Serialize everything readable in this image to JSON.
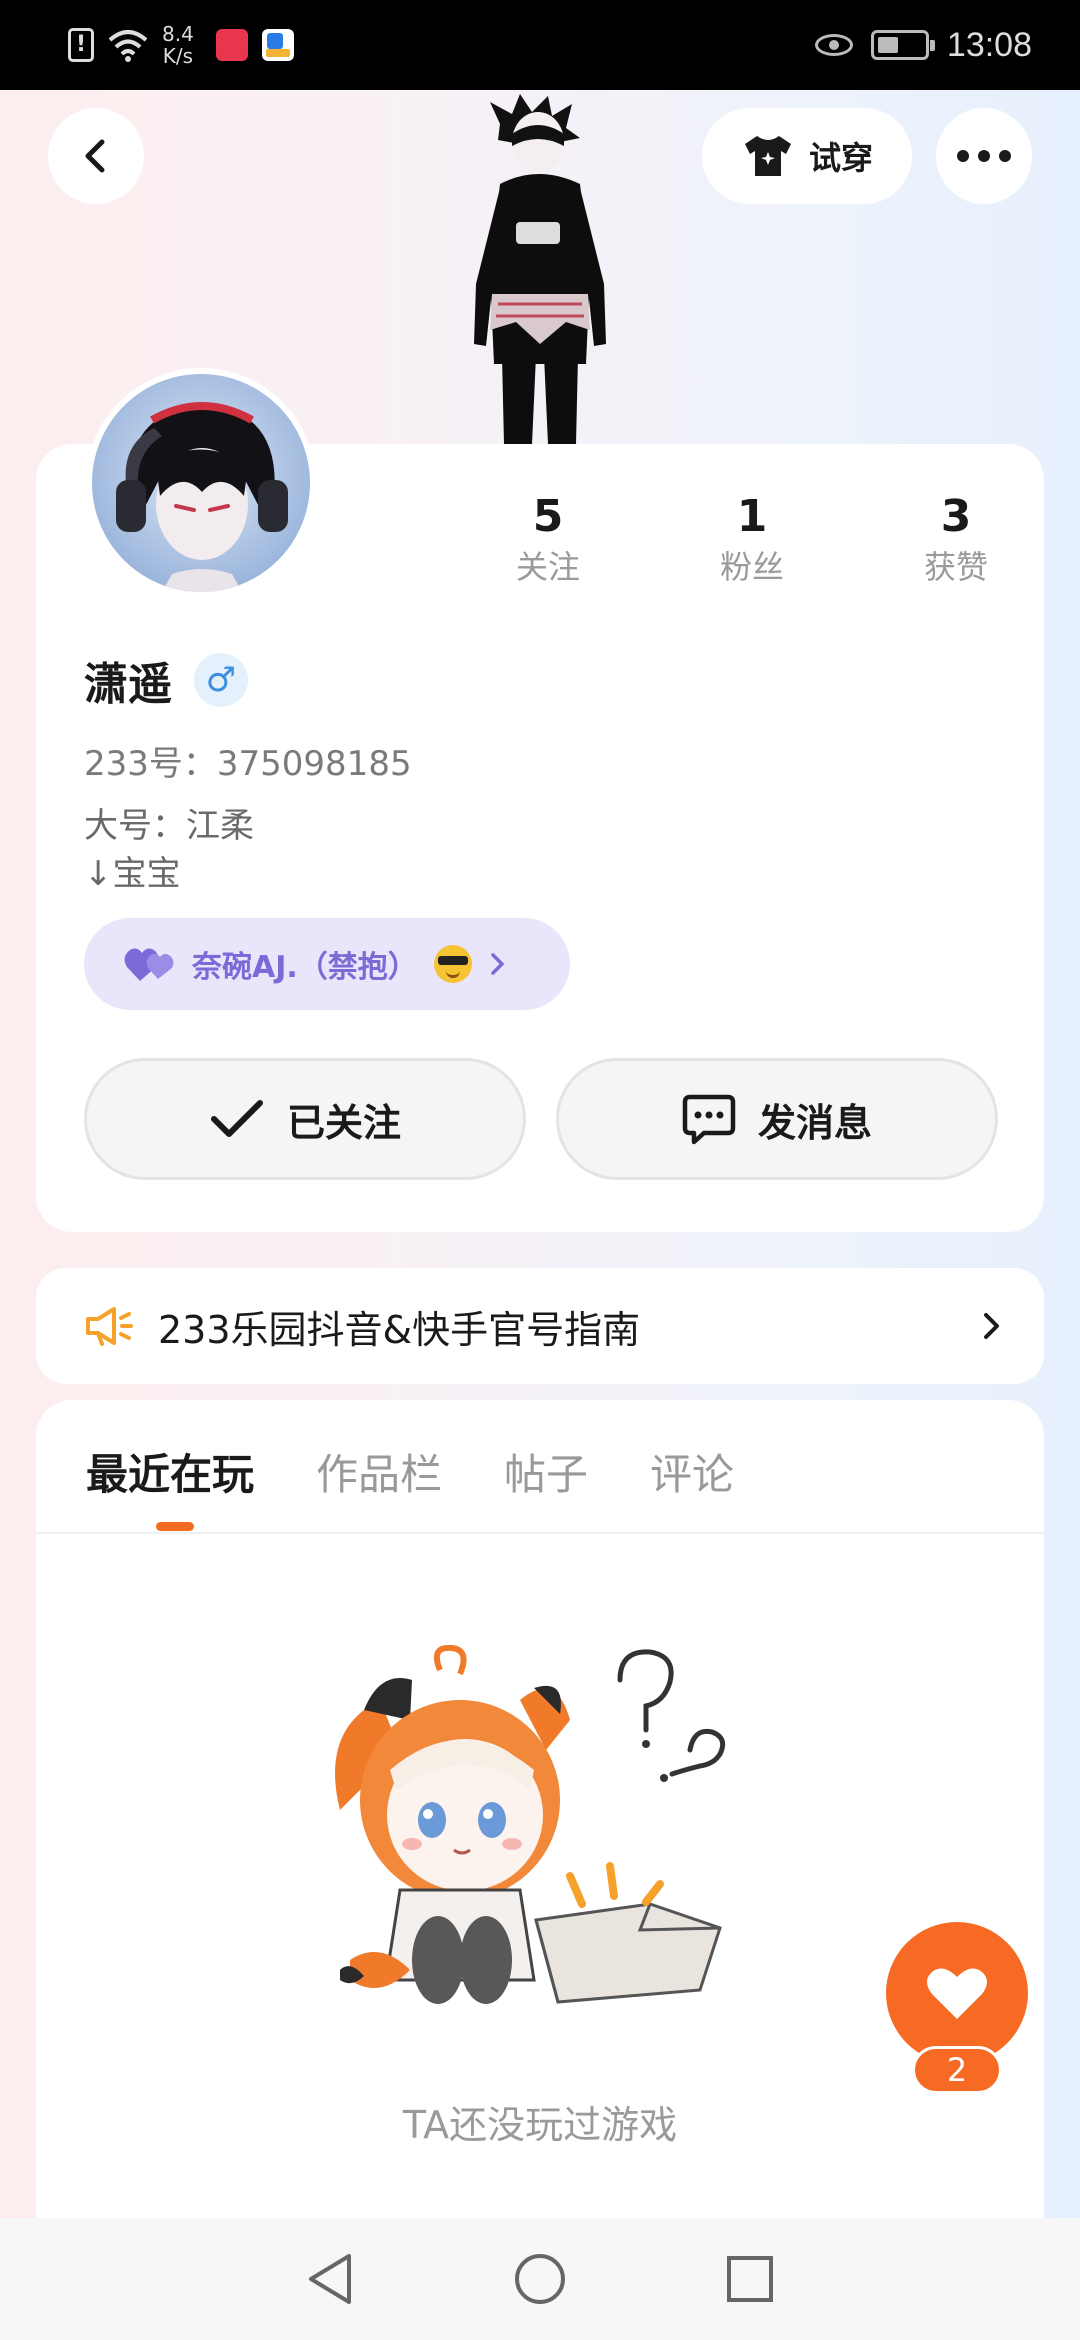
{
  "status_bar": {
    "speed_value": "8.4",
    "speed_unit": "K/s",
    "time": "13:08"
  },
  "header": {
    "try_on_label": "试穿"
  },
  "profile": {
    "stats": [
      {
        "value": "5",
        "label": "关注"
      },
      {
        "value": "1",
        "label": "粉丝"
      },
      {
        "value": "3",
        "label": "获赞"
      }
    ],
    "name": "潇遥",
    "gender_symbol": "♂",
    "id_line": "233号：375098185",
    "bio_lines": [
      "大号：江柔",
      "↓宝宝"
    ],
    "couple_name": "奈碗AJ.（禁抱）",
    "follow_label": "已关注",
    "message_label": "发消息"
  },
  "notice": {
    "text": "233乐园抖音&快手官号指南"
  },
  "tabs": {
    "items": [
      "最近在玩",
      "作品栏",
      "帖子",
      "评论"
    ],
    "active_index": 0
  },
  "empty_state": {
    "text": "TA还没玩过游戏"
  },
  "fab": {
    "count": "2"
  },
  "colors": {
    "accent": "#f66a24",
    "couple_bg": "#e9e6fb",
    "couple_text": "#7a6bd6",
    "gender": "#3b8ee0"
  }
}
